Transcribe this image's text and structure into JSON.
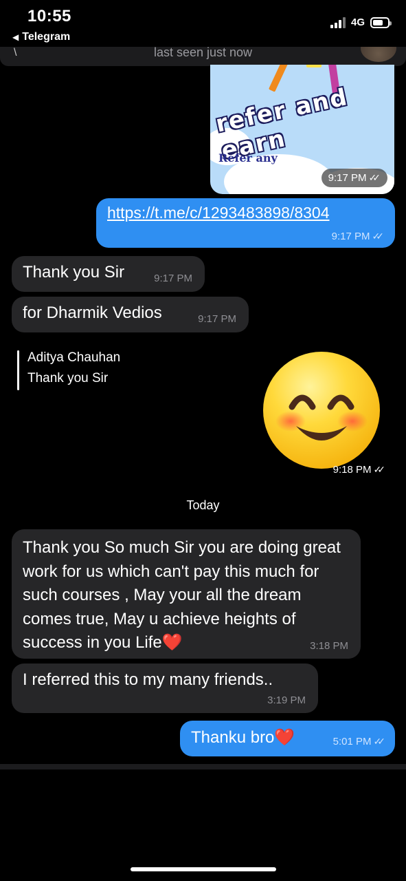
{
  "status_bar": {
    "time": "10:55",
    "back_app": "Telegram",
    "network": "4G"
  },
  "header": {
    "subtitle": "last seen just now"
  },
  "image_message": {
    "title_text": "refer and earn",
    "caption_text": "Refer any",
    "time": "9:17 PM"
  },
  "messages": [
    {
      "id": "link",
      "direction": "out",
      "text": "https://t.me/c/1293483898/8304",
      "time": "9:17 PM"
    },
    {
      "id": "thank",
      "direction": "in",
      "text": "Thank you Sir",
      "time": "9:17 PM"
    },
    {
      "id": "dharmik",
      "direction": "in",
      "text": "for Dharmik Vedios",
      "time": "9:17 PM"
    }
  ],
  "reply_message": {
    "quoted_name": "Aditya Chauhan",
    "quoted_text": "Thank you Sir",
    "sticker": "smiling-emoji",
    "time": "9:18 PM"
  },
  "date_separator": "Today",
  "today_messages": [
    {
      "id": "long",
      "direction": "in",
      "text": "Thank you So much Sir you are doing great work for us which can't pay this much for such courses , May your all the dream comes true, May u achieve heights of success in you Life❤️",
      "time": "3:18 PM"
    },
    {
      "id": "referred",
      "direction": "in",
      "text": "I referred this to my many friends..",
      "time": "3:19 PM"
    },
    {
      "id": "thanku",
      "direction": "out",
      "text": "Thanku bro❤️",
      "time": "5:01 PM"
    }
  ],
  "colors": {
    "background": "#000000",
    "incoming_bubble": "#262628",
    "outgoing_bubble": "#2f8ff2"
  }
}
